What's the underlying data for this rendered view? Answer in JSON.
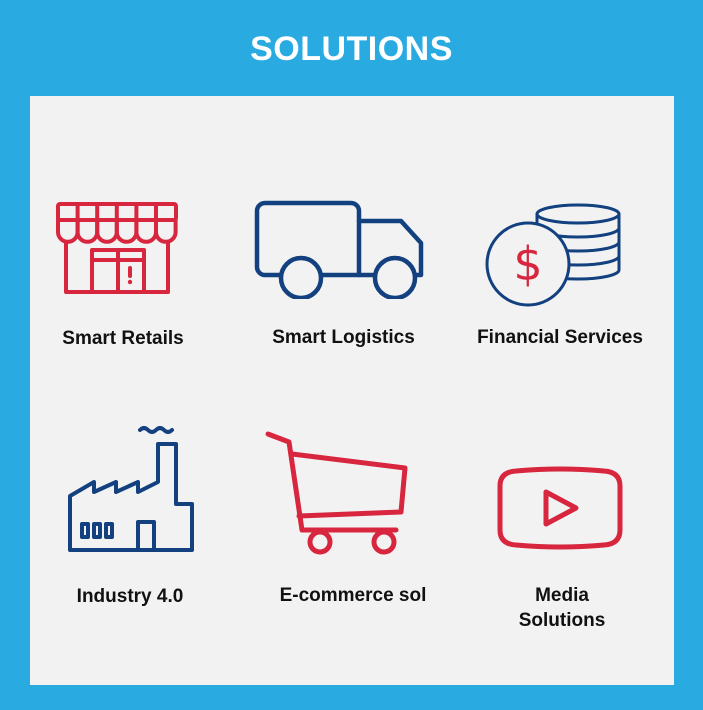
{
  "header": {
    "title": "SOLUTIONS"
  },
  "colors": {
    "background": "#29abe2",
    "panel": "#f2f2f2",
    "red": "#d7263d",
    "navy": "#13407f"
  },
  "solutions": [
    {
      "label": "Smart Retails",
      "icon": "store-icon"
    },
    {
      "label": "Smart Logistics",
      "icon": "truck-icon"
    },
    {
      "label": "Financial Services",
      "icon": "coins-dollar-icon"
    },
    {
      "label": "Industry 4.0",
      "icon": "factory-icon"
    },
    {
      "label": "E-commerce sol",
      "icon": "shopping-cart-icon"
    },
    {
      "label": "Media Solutions",
      "label_line1": "Media",
      "label_line2": "Solutions",
      "icon": "play-button-icon"
    }
  ]
}
